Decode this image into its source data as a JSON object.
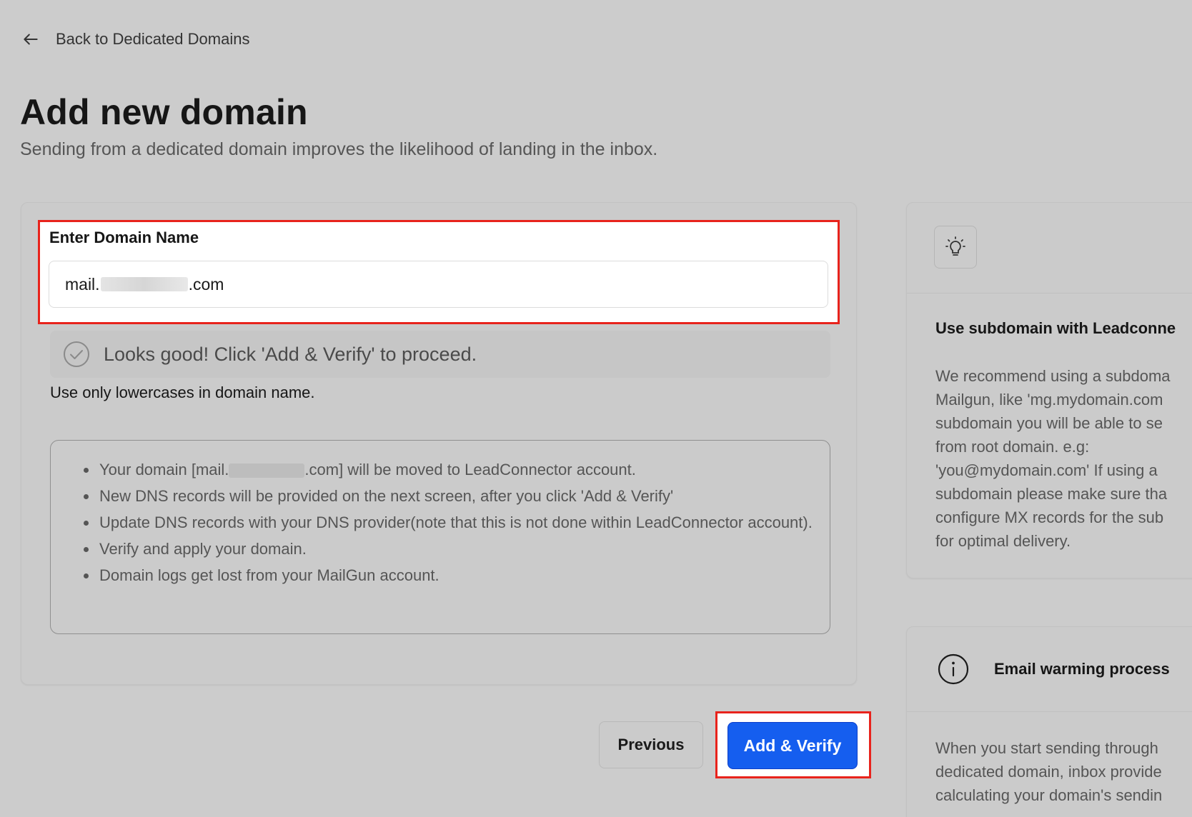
{
  "nav": {
    "back_label": "Back to Dedicated Domains"
  },
  "header": {
    "title": "Add new domain",
    "subtitle": "Sending from a dedicated domain improves the likelihood of landing in the inbox."
  },
  "form": {
    "domain_label": "Enter Domain Name",
    "domain_prefix": "mail.",
    "domain_suffix": ".com",
    "success_message": "Looks good! Click 'Add & Verify' to proceed.",
    "hint": "Use only lowercases in domain name.",
    "info_items": {
      "item1_prefix": "Your domain [mail.",
      "item1_suffix": ".com] will be moved to LeadConnector account.",
      "item2": "New DNS records will be provided on the next screen, after you click 'Add & Verify'",
      "item3": "Update DNS records with your DNS provider(note that this is not done within LeadConnector account).",
      "item4": "Verify and apply your domain.",
      "item5": "Domain logs get lost from your MailGun account."
    }
  },
  "actions": {
    "previous_label": "Previous",
    "add_verify_label": "Add & Verify"
  },
  "tip_card": {
    "title": "Use subdomain with Leadconne",
    "body": "We recommend using a subdoma\nMailgun, like 'mg.mydomain.com\nsubdomain you will be able to se\nfrom root domain. e.g:\n'you@mydomain.com' If using a \nsubdomain please make sure tha\nconfigure MX records for the sub\nfor optimal delivery."
  },
  "warming_card": {
    "title": "Email warming process",
    "body": "When you start sending through\ndedicated domain, inbox provide\ncalculating your domain's sendin"
  },
  "colors": {
    "primary": "#155eef",
    "highlight": "#e8231c",
    "background": "#cccccc"
  }
}
